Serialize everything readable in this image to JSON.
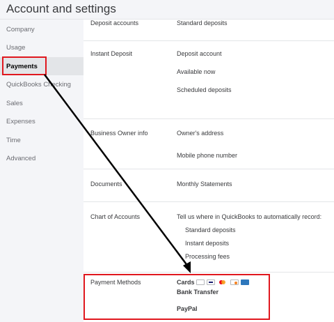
{
  "header": {
    "title": "Account and settings"
  },
  "sidebar": {
    "items": [
      {
        "label": "Company"
      },
      {
        "label": "Usage"
      },
      {
        "label": "Payments"
      },
      {
        "label": "QuickBooks Checking"
      },
      {
        "label": "Sales"
      },
      {
        "label": "Expenses"
      },
      {
        "label": "Time"
      },
      {
        "label": "Advanced"
      }
    ],
    "active": "Payments"
  },
  "main": {
    "deposit_accounts": {
      "label": "Deposit accounts",
      "value": "Standard deposits"
    },
    "instant_deposit": {
      "label": "Instant Deposit",
      "values": [
        "Deposit account",
        "Available now",
        "Scheduled deposits"
      ]
    },
    "business_owner": {
      "label": "Business Owner info",
      "values": [
        "Owner's address",
        "Mobile phone number"
      ]
    },
    "documents": {
      "label": "Documents",
      "value": "Monthly Statements"
    },
    "chart_of_accounts": {
      "label": "Chart of Accounts",
      "intro": "Tell us where in QuickBooks to automatically record:",
      "values": [
        "Standard deposits",
        "Instant deposits",
        "Processing fees"
      ]
    },
    "payment_methods": {
      "label": "Payment Methods",
      "cards": "Cards",
      "bank": "Bank Transfer",
      "paypal": "PayPal"
    }
  },
  "card_icons": [
    "apple-pay-icon",
    "visa-icon",
    "mastercard-icon",
    "discover-icon",
    "amex-icon"
  ],
  "colors": {
    "highlight": "#e0171e",
    "arrow": "#000000",
    "sidebar_bg": "#f4f5f8",
    "active_bg": "#e3e5e8"
  }
}
